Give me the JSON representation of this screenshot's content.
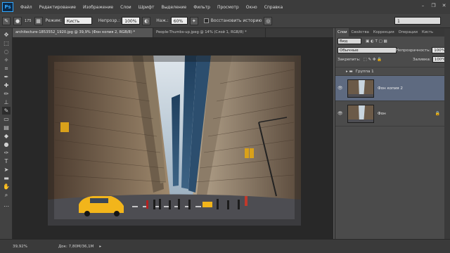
{
  "menu": {
    "logo": "Ps",
    "items": [
      "Файл",
      "Редактирование",
      "Изображение",
      "Слои",
      "Шрифт",
      "Выделение",
      "Фильтр",
      "Просмотр",
      "Окно",
      "Справка"
    ]
  },
  "options": {
    "brush_size": "175",
    "mode_label": "Режим:",
    "mode_value": "Кисть",
    "opacity_label": "Непрозр.:",
    "opacity_value": "100%",
    "pressure_label": "Наж.:",
    "pressure_value": "60%",
    "restore_history_label": "Восстановить историю",
    "workspace_value": "1"
  },
  "tabs": [
    "architecture-1853552_1920.jpg @ 39,9% (Фон копия 2, RGB/8) *",
    "People-Thumbs-up.jpeg @ 14% (Слой 1, RGB/8) *"
  ],
  "status": {
    "zoom": "39,92%",
    "doc": "Док: 7,80M/36,1M"
  },
  "layers_panel": {
    "tabs": [
      "Слои",
      "Свойства",
      "Коррекция",
      "Операции",
      "Кисть"
    ],
    "filter_label": "Вид",
    "blend_mode": "Обычные",
    "opacity_label": "Непрозрачность:",
    "opacity_value": "100%",
    "lock_label": "Закрепить:",
    "fill_label": "Заливка:",
    "fill_value": "100%",
    "group_name": "Группа 1",
    "layers": [
      {
        "name": "Фон копия 2",
        "selected": true
      },
      {
        "name": "Фон",
        "selected": false
      }
    ]
  },
  "colors": {
    "foreground": "#e1191b",
    "background": "#111111",
    "selection": "#5e6a80"
  }
}
